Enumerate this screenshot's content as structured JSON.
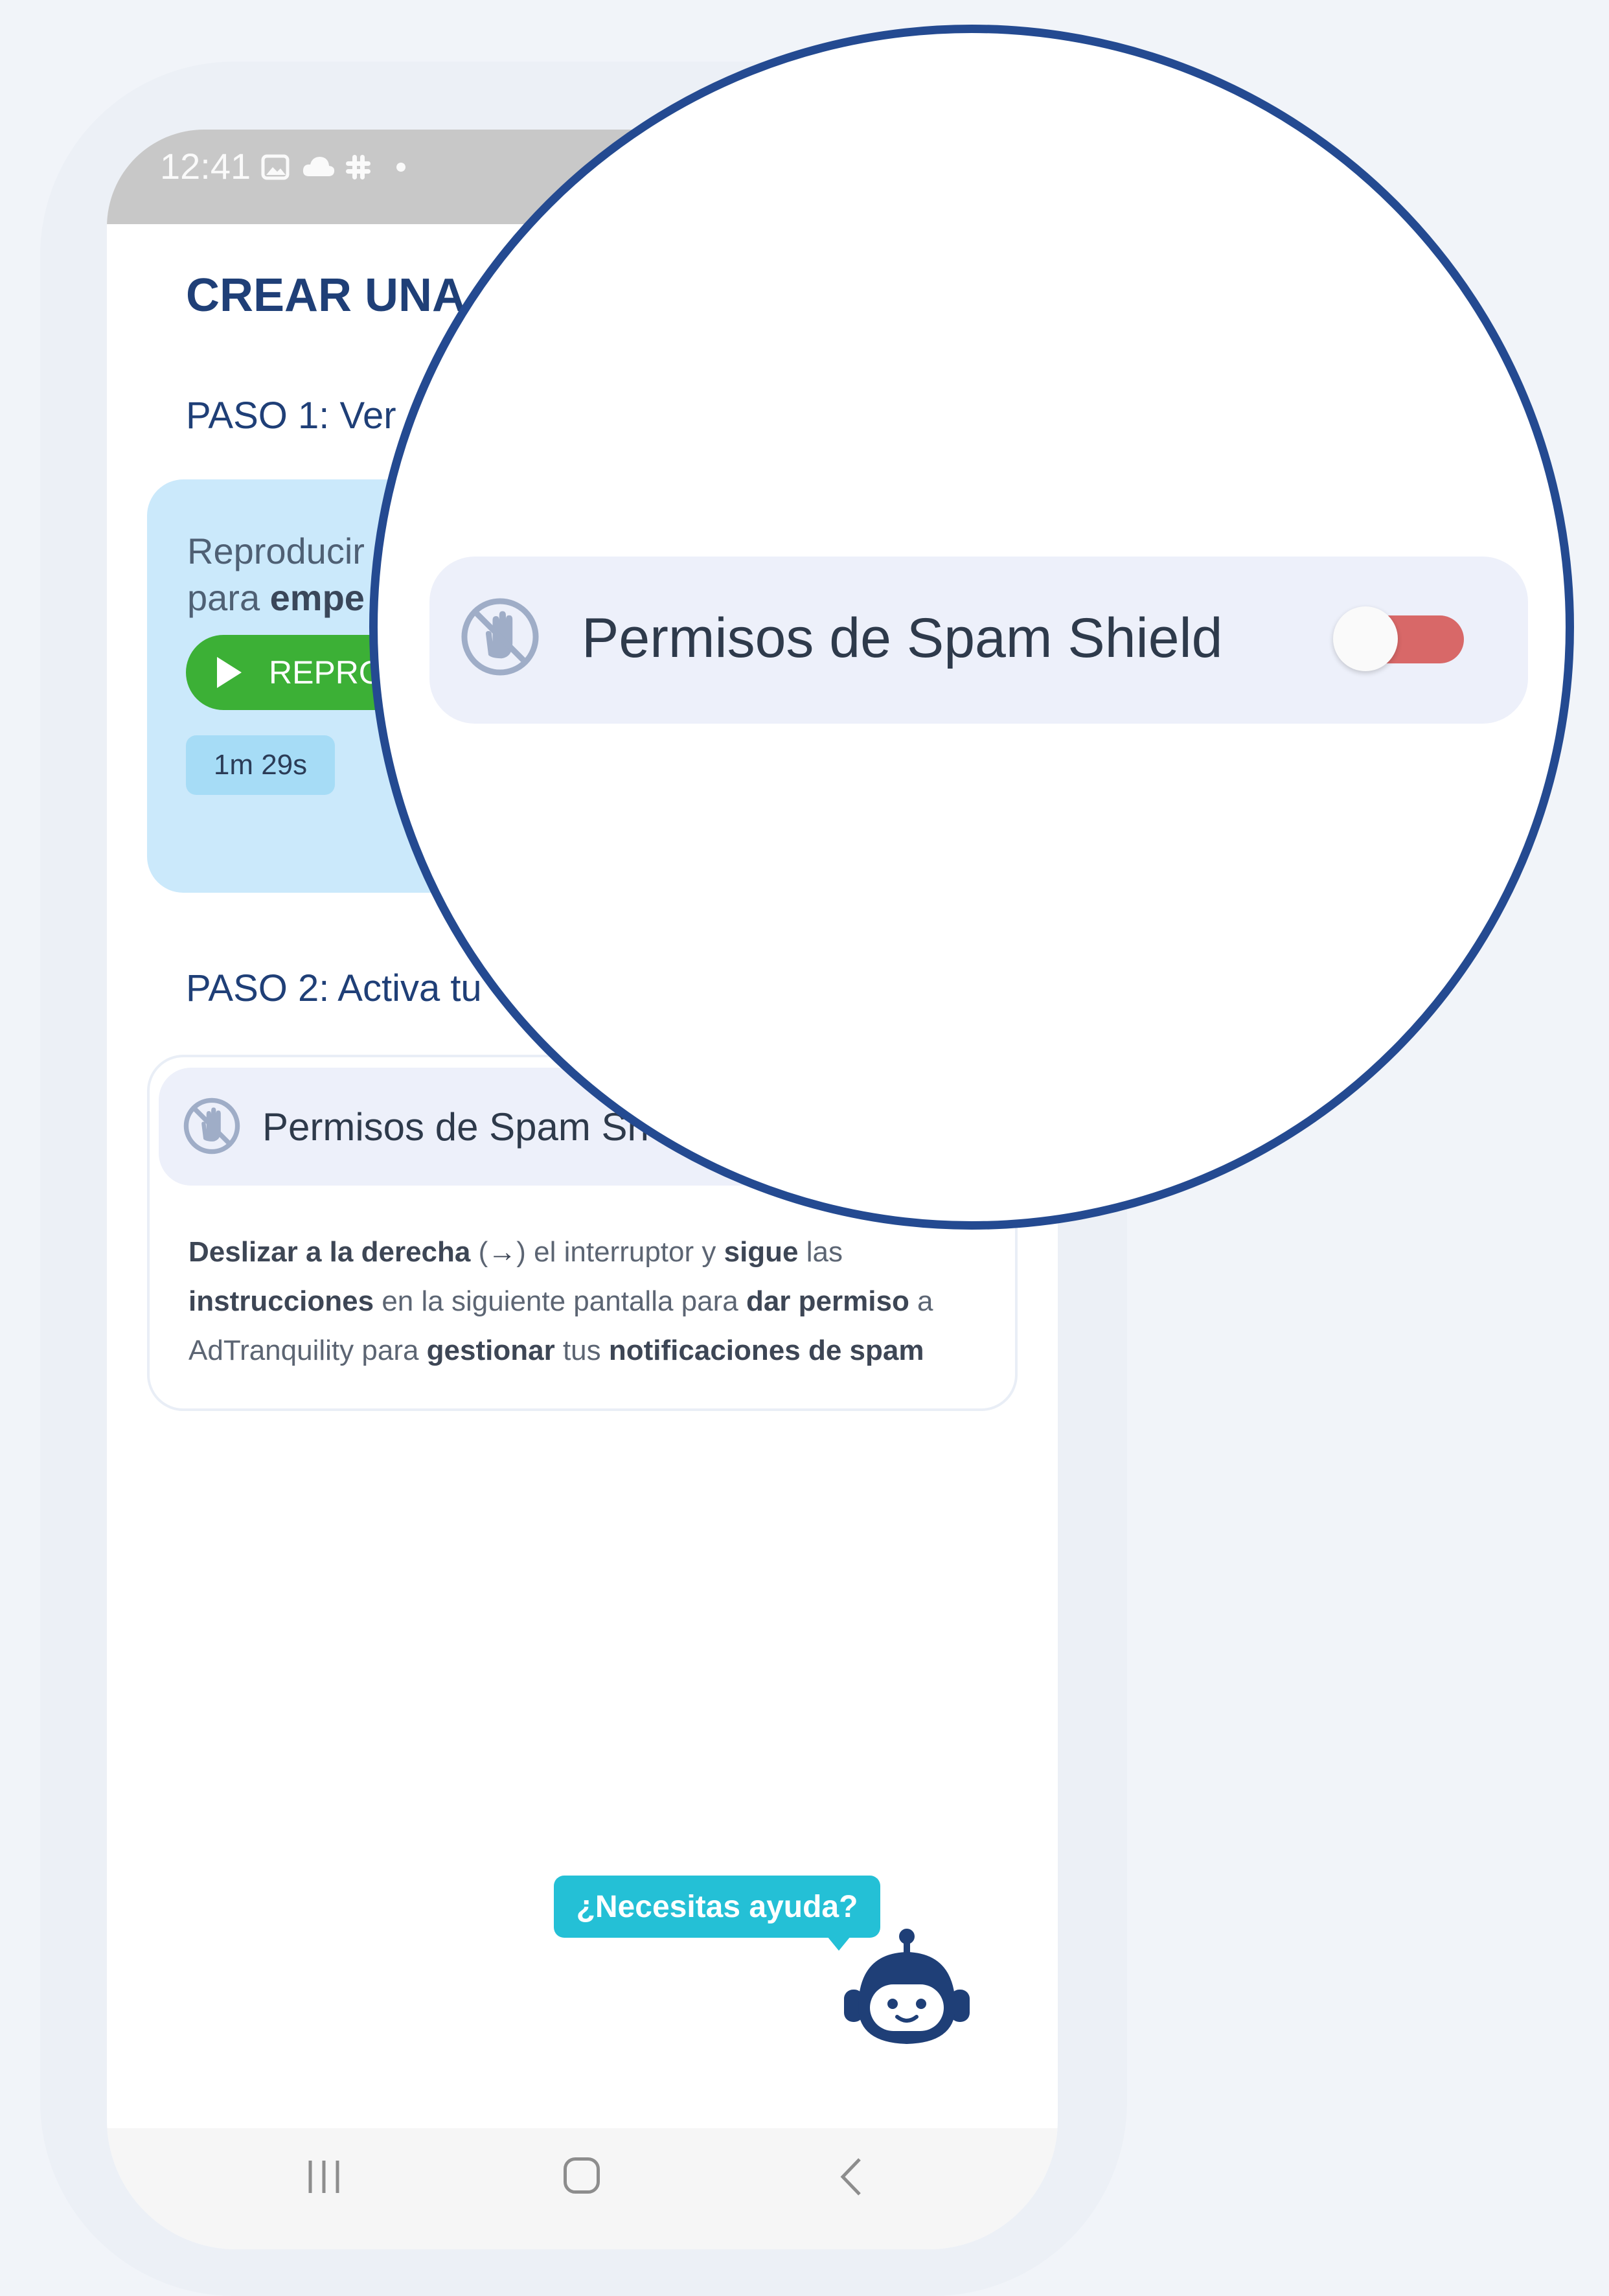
{
  "status_bar": {
    "time": "12:41",
    "icons": [
      "image-icon",
      "cloud-icon",
      "slack-icon",
      "dot-icon"
    ]
  },
  "page": {
    "title": "CREAR UNA"
  },
  "step1": {
    "title": "PASO 1: Ver",
    "video_text_prefix": "Reproducir",
    "video_text_line2_prefix": "para ",
    "video_text_line2_bold": "empe",
    "play_button_label": "REPRO",
    "duration": "1m 29s"
  },
  "step2": {
    "title": "PASO 2: Activa tu",
    "permission_label": "Permisos de Spam Sh",
    "instructions": [
      {
        "text": "Deslizar a la derecha",
        "bold": true
      },
      {
        "text": " (",
        "bold": false
      },
      {
        "text": "→",
        "bold": true
      },
      {
        "text": ") el interruptor y ",
        "bold": false
      },
      {
        "text": "sigue",
        "bold": true
      },
      {
        "text": " las ",
        "bold": false
      },
      {
        "text": "instrucciones",
        "bold": true
      },
      {
        "text": " en la siguiente pantalla para ",
        "bold": false
      },
      {
        "text": "dar permiso",
        "bold": true
      },
      {
        "text": " a AdTranquility para ",
        "bold": false
      },
      {
        "text": "gestionar",
        "bold": true
      },
      {
        "text": " tus ",
        "bold": false
      },
      {
        "text": "notificaciones de spam",
        "bold": true
      }
    ]
  },
  "help": {
    "label": "¿Necesitas ayuda?"
  },
  "magnifier": {
    "label": "Permisos de Spam Shield",
    "toggle_on": false,
    "toggle_track_color": "#d86868"
  },
  "nav_bar": {
    "icons": [
      "recents-icon",
      "home-icon",
      "back-icon"
    ]
  },
  "colors": {
    "accent_dark": "#1f3f77",
    "green": "#3cb036",
    "cyan": "#24c0d6",
    "magnifier_border": "#244a91"
  }
}
